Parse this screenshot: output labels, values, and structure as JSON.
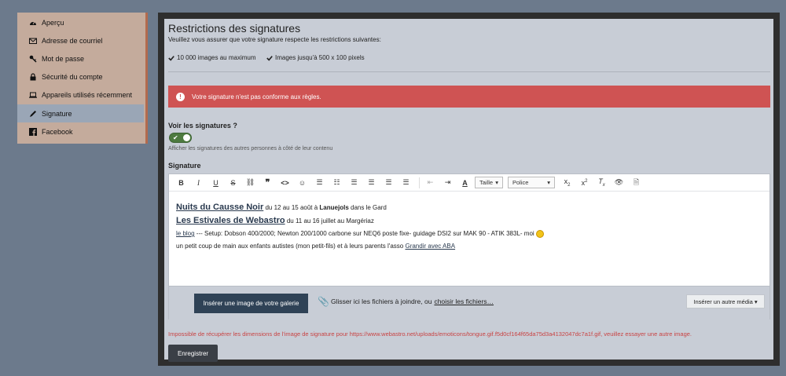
{
  "sidebar": {
    "items": [
      {
        "label": "Aperçu",
        "icon": "dashboard-icon"
      },
      {
        "label": "Adresse de courriel",
        "icon": "envelope-icon"
      },
      {
        "label": "Mot de passe",
        "icon": "key-icon"
      },
      {
        "label": "Sécurité du compte",
        "icon": "lock-icon"
      },
      {
        "label": "Appareils utilisés récemment",
        "icon": "laptop-icon"
      },
      {
        "label": "Signature",
        "icon": "pencil-icon",
        "active": true
      },
      {
        "label": "Facebook",
        "icon": "facebook-icon"
      }
    ]
  },
  "restrictions": {
    "title": "Restrictions des signatures",
    "subtitle": "Veuillez vous assurer que votre signature respecte les restrictions suivantes:",
    "items": [
      "10 000 images au maximum",
      "Images jusqu'à 500 x 100 pixels"
    ]
  },
  "alert": {
    "text": "Votre signature n'est pas conforme aux règles."
  },
  "view_signatures": {
    "label": "Voir les signatures ?",
    "hint": "Afficher les signatures des autres personnes à côté de leur contenu",
    "enabled": true
  },
  "signature": {
    "label": "Signature",
    "toolbar": {
      "size_label": "Taille",
      "font_label": "Police"
    },
    "content": {
      "line1_link": "Nuits du Causse Noir",
      "line1_a": " du 12 au 15 août à ",
      "line1_bold": "Lanuejols",
      "line1_b": " dans le Gard",
      "line2_link": "Les Estivales de Webastro",
      "line2_a": " du 11 au 16 juillet au Margériaz",
      "line3_link": "le blog",
      "line3_a": " --- Setup: Dobson 400/2000; Newton 200/1000 carbone sur NEQ6 poste fixe- guidage DSI2 sur MAK 90 - ATIK 383L- moi ",
      "line4_a": "un petit coup de main aux enfants autistes (mon petit-fils) et à leurs parents l'asso ",
      "line4_link": "Grandir avec ABA"
    },
    "footer": {
      "insert_gallery": "Insérer une image de votre galerie",
      "drop_text": "Glisser ici les fichiers à joindre, ou",
      "choose_files": "choisir les fichiers…",
      "insert_media": "Insérer un autre média"
    }
  },
  "error_text": "Impossible de récupérer les dimensions de l'image de signature pour https://www.webastro.net/uploads/emoticons/tongue.gif.f5d0cf164f65da75d3a4132047dc7a1f.gif, veuillez essayer une autre image.",
  "save_label": "Enregistrer",
  "colors": {
    "alert": "#cf5353",
    "sidebar": "#c4ab9c",
    "active": "#9aa6b6",
    "button": "#2f4256",
    "toggle": "#4d7a3f",
    "error": "#c94343"
  }
}
